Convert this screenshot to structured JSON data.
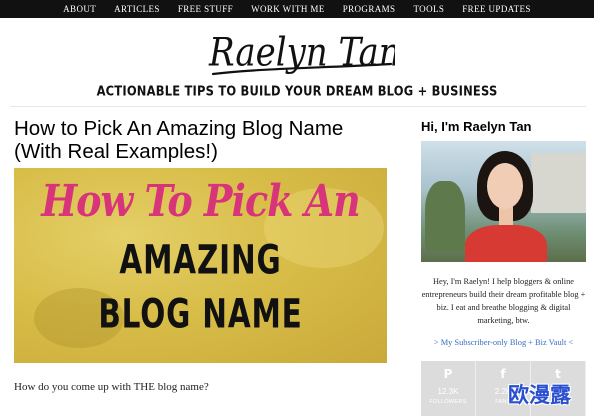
{
  "nav": {
    "items": [
      {
        "label": "ABOUT"
      },
      {
        "label": "ARTICLES"
      },
      {
        "label": "FREE STUFF"
      },
      {
        "label": "WORK WITH ME"
      },
      {
        "label": "PROGRAMS"
      },
      {
        "label": "TOOLS"
      },
      {
        "label": "FREE UPDATES"
      }
    ]
  },
  "header": {
    "logo_text": "Raelyn Tan",
    "tagline": "ACTIONABLE TIPS TO BUILD YOUR DREAM BLOG + BUSINESS"
  },
  "article": {
    "title": "How to Pick An Amazing Blog Name (With Real Examples!)",
    "hero": {
      "line1": "How To Pick An",
      "line2": "AMAZING",
      "line3": "BLOG NAME"
    },
    "intro": "How do you come up with THE blog name?"
  },
  "sidebar": {
    "title": "Hi, I'm Raelyn Tan",
    "bio": "Hey, I'm Raelyn! I help bloggers & online entrepreneurs build their dream profitable blog + biz. I eat and breathe blogging & digital marketing, btw.",
    "vault_link": "> My Subscriber-only Blog + Biz Vault <",
    "social": [
      {
        "icon": "pinterest-icon",
        "glyph": "P",
        "count": "12.3K",
        "label": "FOLLOWERS"
      },
      {
        "icon": "facebook-icon",
        "glyph": "f",
        "count": "2.2K",
        "label": "FANS"
      },
      {
        "icon": "twitter-icon",
        "glyph": "t",
        "count": "",
        "label": ""
      }
    ]
  },
  "watermark": "欧漫露",
  "colors": {
    "nav_bg": "#111111",
    "hero_pink": "#d8347a",
    "hero_gold": "#d8bd48",
    "link_blue": "#3a6fc4",
    "social_bg": "#dcdcdc"
  }
}
